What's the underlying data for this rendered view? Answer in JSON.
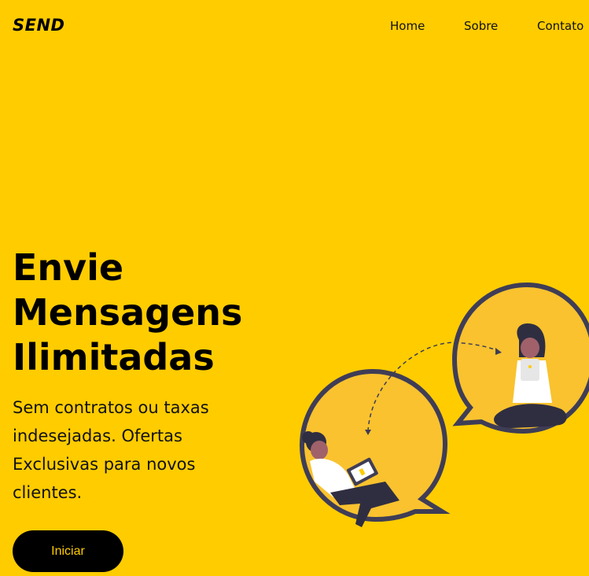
{
  "header": {
    "logo": "SEND",
    "nav": [
      "Home",
      "Sobre",
      "Contato"
    ]
  },
  "hero": {
    "title_lines": [
      "Envie",
      "Mensagens",
      "Ilimitadas"
    ],
    "subtitle": "Sem contratos ou taxas indesejadas. Ofertas Exclusivas para novos clientes.",
    "cta_label": "Iniciar"
  },
  "colors": {
    "background": "#FFCC00",
    "bubble_fill": "#F9C22E",
    "bubble_outline": "#3F3D56",
    "button_bg": "#000000",
    "button_text": "#FFCC00"
  },
  "illustration": {
    "icon": "chat-people-illustration"
  }
}
